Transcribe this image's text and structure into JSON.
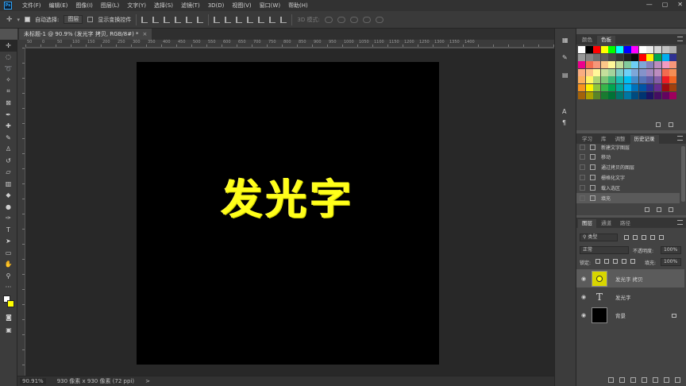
{
  "menu": {
    "logo": "Ps",
    "items": [
      "文件(F)",
      "编辑(E)",
      "图像(I)",
      "图层(L)",
      "文字(Y)",
      "选择(S)",
      "滤镜(T)",
      "3D(D)",
      "视图(V)",
      "窗口(W)",
      "帮助(H)"
    ],
    "win_min": "—",
    "win_max": "▢",
    "win_close": "✕"
  },
  "options": {
    "auto_select_label": "自动选择:",
    "auto_select_value": "图层",
    "transform_label": "显示变换控件",
    "mode3d_label": "3D 模式:"
  },
  "doc": {
    "tab_label": "未标题-1 @ 90.9% (发光字 拷贝, RGB/8#) *",
    "close": "×",
    "canvas_text": "发光字",
    "bg_color": "#000000",
    "text_color": "#ffff1a"
  },
  "ruler": {
    "top_nums": [
      "50",
      "0",
      "50",
      "100",
      "150",
      "200",
      "250",
      "300",
      "350",
      "400",
      "450",
      "500",
      "550",
      "600",
      "650",
      "700",
      "750",
      "800",
      "850",
      "900",
      "950",
      "1000",
      "1050",
      "1100",
      "1150",
      "1200",
      "1250",
      "1300",
      "1350",
      "1400"
    ]
  },
  "status": {
    "zoom": "90.91%",
    "doc_size": "930 像素 x 930 像素 (72 ppi)",
    "arrow": ">"
  },
  "dock": {
    "items": [
      {
        "name": "swatches-dock-icon",
        "glyph": "▦"
      },
      {
        "name": "brush-dock-icon",
        "glyph": "✎"
      },
      {
        "name": "adjust-dock-icon",
        "glyph": "▤"
      },
      {
        "name": "char-dock-icon",
        "glyph": "A"
      },
      {
        "name": "para-dock-icon",
        "glyph": "¶"
      }
    ]
  },
  "swatch_panel": {
    "tabs": [
      "颜色",
      "色板"
    ],
    "active": 1,
    "colors": [
      "#ffffff",
      "#000000",
      "#ff0000",
      "#ffff00",
      "#00ff00",
      "#00ffff",
      "#0000ff",
      "#ff00ff",
      "#ffffff",
      "#ebebeb",
      "#d6d6d6",
      "#c2c2c2",
      "#adadad",
      "#999999",
      "#858585",
      "#707070",
      "#5c5c5c",
      "#474747",
      "#333333",
      "#1f1f1f",
      "#0a0a0a",
      "#ff0000",
      "#fff200",
      "#00a650",
      "#00aeef",
      "#2e3192",
      "#ec008c",
      "#f26c4f",
      "#f69679",
      "#fdc689",
      "#fff799",
      "#c4df9b",
      "#82ca9c",
      "#6dcff6",
      "#7ea7d8",
      "#8781bd",
      "#bd8cbf",
      "#f49ac1",
      "#f7977a",
      "#f9ad81",
      "#fdc68a",
      "#fff79a",
      "#c4df9b",
      "#a3d39c",
      "#7accc8",
      "#6ecff6",
      "#7da7d9",
      "#8493ca",
      "#a187be",
      "#bc8cbf",
      "#f26c4f",
      "#f68e55",
      "#fbaf5c",
      "#fff467",
      "#acd372",
      "#7cc576",
      "#3bb878",
      "#1abbb4",
      "#00bff3",
      "#438ccb",
      "#5574b9",
      "#605ca8",
      "#855fa8",
      "#ed1c24",
      "#f26522",
      "#f7941d",
      "#fff200",
      "#8dc63f",
      "#39b54a",
      "#00a651",
      "#00a99d",
      "#00aeef",
      "#0072bc",
      "#0054a6",
      "#2e3192",
      "#662d91",
      "#9e0b0f",
      "#a0410d",
      "#a36209",
      "#aba000",
      "#598527",
      "#197b30",
      "#007236",
      "#00746b",
      "#0076a3",
      "#004b80",
      "#003471",
      "#1b1464",
      "#440e62",
      "#630460",
      "#9e005d"
    ]
  },
  "history_panel": {
    "tabs": [
      "学习",
      "库",
      "调整",
      "历史记录"
    ],
    "active": 3,
    "items": [
      "新建文字图层",
      "移动",
      "通过拷贝的图层",
      "栅格化文字",
      "载入选区",
      "填充"
    ],
    "active_item": 5
  },
  "layers_panel": {
    "tabs": [
      "图层",
      "通道",
      "路径"
    ],
    "active": 0,
    "filter_label": "类型",
    "blend_mode": "正常",
    "opacity_label": "不透明度:",
    "opacity_value": "100%",
    "lock_label": "锁定:",
    "fill_label": "填充:",
    "fill_value": "100%",
    "layers": [
      {
        "name": "发光字 拷贝",
        "kind": "pixel",
        "selected": true
      },
      {
        "name": "发光字",
        "kind": "text",
        "selected": false
      },
      {
        "name": "背景",
        "kind": "background",
        "selected": false
      }
    ],
    "text_glyph": "T",
    "eye_glyph": "👁"
  },
  "colors": {
    "accent_yellow": "#ffff00",
    "fg": "#ffffff",
    "bg": "#ffff00"
  }
}
